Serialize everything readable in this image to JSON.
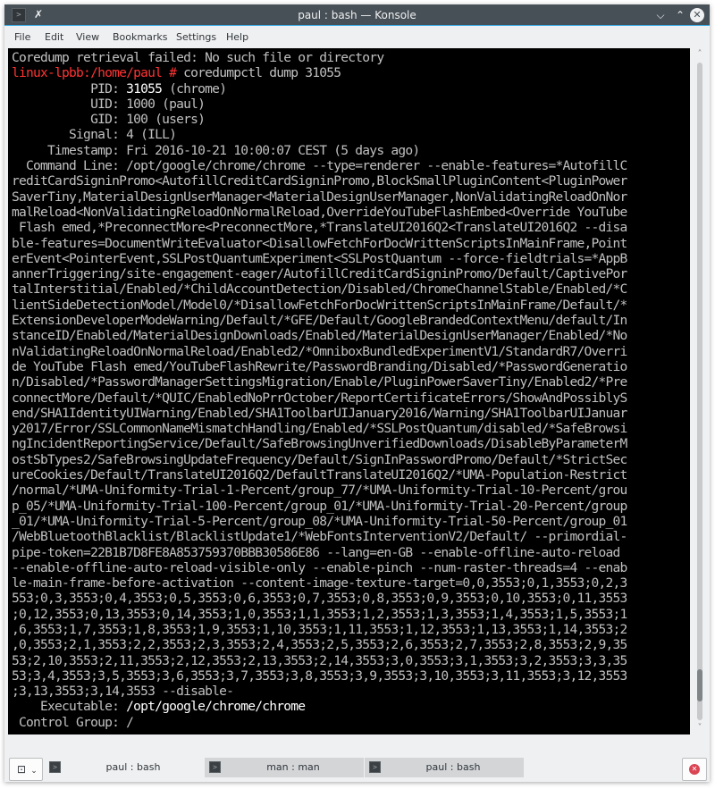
{
  "window": {
    "title": "paul : bash — Konsole",
    "icons": {
      "app": "terminal-icon",
      "pin": "pin-icon",
      "minimize": "chevron-down-icon",
      "maximize": "chevron-up-icon",
      "close": "close-icon"
    },
    "app_icon_glyph": ">",
    "pin_glyph": "✗",
    "minimize_glyph": "⌄",
    "maximize_glyph": "⌃",
    "close_glyph": "✕"
  },
  "menubar": {
    "items": [
      {
        "label": "File"
      },
      {
        "label": "Edit"
      },
      {
        "label": "View"
      },
      {
        "label": "Bookmarks"
      },
      {
        "label": "Settings"
      },
      {
        "label": "Help"
      }
    ]
  },
  "terminal": {
    "lines": [
      {
        "parts": [
          {
            "text": "Coredump retrieval failed: No such file or directory",
            "style": "normal"
          }
        ]
      },
      {
        "parts": [
          {
            "text": "linux-lpbb:/home/paul #",
            "style": "prompt"
          },
          {
            "text": " coredumpctl dump 31055",
            "style": "normal"
          }
        ]
      },
      {
        "parts": [
          {
            "text": "           PID: ",
            "style": "normal"
          },
          {
            "text": "31055",
            "style": "bright"
          },
          {
            "text": " (chrome)",
            "style": "normal"
          }
        ]
      },
      {
        "parts": [
          {
            "text": "           UID: 1000 (paul)",
            "style": "normal"
          }
        ]
      },
      {
        "parts": [
          {
            "text": "           GID: 100 (users)",
            "style": "normal"
          }
        ]
      },
      {
        "parts": [
          {
            "text": "        Signal: 4 (ILL)",
            "style": "normal"
          }
        ]
      },
      {
        "parts": [
          {
            "text": "     Timestamp: Fri 2016-10-21 10:00:07 CEST (5 days ago)",
            "style": "normal"
          }
        ]
      },
      {
        "parts": [
          {
            "text": "  Command Line: /opt/google/chrome/chrome --type=renderer --enable-features=*AutofillC",
            "style": "normal"
          }
        ]
      },
      {
        "parts": [
          {
            "text": "reditCardSigninPromo<AutofillCreditCardSigninPromo,BlockSmallPluginContent<PluginPower",
            "style": "normal"
          }
        ]
      },
      {
        "parts": [
          {
            "text": "SaverTiny,MaterialDesignUserManager<MaterialDesignUserManager,NonValidatingReloadOnNor",
            "style": "normal"
          }
        ]
      },
      {
        "parts": [
          {
            "text": "malReload<NonValidatingReloadOnNormalReload,OverrideYouTubeFlashEmbed<Override YouTube",
            "style": "normal"
          }
        ]
      },
      {
        "parts": [
          {
            "text": " Flash emed,*PreconnectMore<PreconnectMore,*TranslateUI2016Q2<TranslateUI2016Q2 --disa",
            "style": "normal"
          }
        ]
      },
      {
        "parts": [
          {
            "text": "ble-features=DocumentWriteEvaluator<DisallowFetchForDocWrittenScriptsInMainFrame,Point",
            "style": "normal"
          }
        ]
      },
      {
        "parts": [
          {
            "text": "erEvent<PointerEvent,SSLPostQuantumExperiment<SSLPostQuantum --force-fieldtrials=*AppB",
            "style": "normal"
          }
        ]
      },
      {
        "parts": [
          {
            "text": "annerTriggering/site-engagement-eager/AutofillCreditCardSigninPromo/Default/CaptivePor",
            "style": "normal"
          }
        ]
      },
      {
        "parts": [
          {
            "text": "talInterstitial/Enabled/*ChildAccountDetection/Disabled/ChromeChannelStable/Enabled/*C",
            "style": "normal"
          }
        ]
      },
      {
        "parts": [
          {
            "text": "lientSideDetectionModel/Model0/*DisallowFetchForDocWrittenScriptsInMainFrame/Default/*",
            "style": "normal"
          }
        ]
      },
      {
        "parts": [
          {
            "text": "ExtensionDeveloperModeWarning/Default/*GFE/Default/GoogleBrandedContextMenu/default/In",
            "style": "normal"
          }
        ]
      },
      {
        "parts": [
          {
            "text": "stanceID/Enabled/MaterialDesignDownloads/Enabled/MaterialDesignUserManager/Enabled/*No",
            "style": "normal"
          }
        ]
      },
      {
        "parts": [
          {
            "text": "nValidatingReloadOnNormalReload/Enabled2/*OmniboxBundledExperimentV1/StandardR7/Overri",
            "style": "normal"
          }
        ]
      },
      {
        "parts": [
          {
            "text": "de YouTube Flash emed/YouTubeFlashRewrite/PasswordBranding/Disabled/*PasswordGeneratio",
            "style": "normal"
          }
        ]
      },
      {
        "parts": [
          {
            "text": "n/Disabled/*PasswordManagerSettingsMigration/Enable/PluginPowerSaverTiny/Enabled2/*Pre",
            "style": "normal"
          }
        ]
      },
      {
        "parts": [
          {
            "text": "connectMore/Default/*QUIC/EnabledNoPrrOctober/ReportCertificateErrors/ShowAndPossiblyS",
            "style": "normal"
          }
        ]
      },
      {
        "parts": [
          {
            "text": "end/SHA1IdentityUIWarning/Enabled/SHA1ToolbarUIJanuary2016/Warning/SHA1ToolbarUIJanuar",
            "style": "normal"
          }
        ]
      },
      {
        "parts": [
          {
            "text": "y2017/Error/SSLCommonNameMismatchHandling/Enabled/*SSLPostQuantum/disabled/*SafeBrowsi",
            "style": "normal"
          }
        ]
      },
      {
        "parts": [
          {
            "text": "ngIncidentReportingService/Default/SafeBrowsingUnverifiedDownloads/DisableByParameterM",
            "style": "normal"
          }
        ]
      },
      {
        "parts": [
          {
            "text": "ostSbTypes2/SafeBrowsingUpdateFrequency/Default/SignInPasswordPromo/Default/*StrictSec",
            "style": "normal"
          }
        ]
      },
      {
        "parts": [
          {
            "text": "ureCookies/Default/TranslateUI2016Q2/DefaultTranslateUI2016Q2/*UMA-Population-Restrict",
            "style": "normal"
          }
        ]
      },
      {
        "parts": [
          {
            "text": "/normal/*UMA-Uniformity-Trial-1-Percent/group_77/*UMA-Uniformity-Trial-10-Percent/grou",
            "style": "normal"
          }
        ]
      },
      {
        "parts": [
          {
            "text": "p_05/*UMA-Uniformity-Trial-100-Percent/group_01/*UMA-Uniformity-Trial-20-Percent/group",
            "style": "normal"
          }
        ]
      },
      {
        "parts": [
          {
            "text": "_01/*UMA-Uniformity-Trial-5-Percent/group_08/*UMA-Uniformity-Trial-50-Percent/group_01",
            "style": "normal"
          }
        ]
      },
      {
        "parts": [
          {
            "text": "/WebBluetoothBlacklist/BlacklistUpdate1/*WebFontsInterventionV2/Default/ --primordial-",
            "style": "normal"
          }
        ]
      },
      {
        "parts": [
          {
            "text": "pipe-token=22B1B7D8FE8A853759370BBB30586E86 --lang=en-GB --enable-offline-auto-reload ",
            "style": "normal"
          }
        ]
      },
      {
        "parts": [
          {
            "text": "--enable-offline-auto-reload-visible-only --enable-pinch --num-raster-threads=4 --enab",
            "style": "normal"
          }
        ]
      },
      {
        "parts": [
          {
            "text": "le-main-frame-before-activation --content-image-texture-target=0,0,3553;0,1,3553;0,2,3",
            "style": "normal"
          }
        ]
      },
      {
        "parts": [
          {
            "text": "553;0,3,3553;0,4,3553;0,5,3553;0,6,3553;0,7,3553;0,8,3553;0,9,3553;0,10,3553;0,11,3553",
            "style": "normal"
          }
        ]
      },
      {
        "parts": [
          {
            "text": ";0,12,3553;0,13,3553;0,14,3553;1,0,3553;1,1,3553;1,2,3553;1,3,3553;1,4,3553;1,5,3553;1",
            "style": "normal"
          }
        ]
      },
      {
        "parts": [
          {
            "text": ",6,3553;1,7,3553;1,8,3553;1,9,3553;1,10,3553;1,11,3553;1,12,3553;1,13,3553;1,14,3553;2",
            "style": "normal"
          }
        ]
      },
      {
        "parts": [
          {
            "text": ",0,3553;2,1,3553;2,2,3553;2,3,3553;2,4,3553;2,5,3553;2,6,3553;2,7,3553;2,8,3553;2,9,35",
            "style": "normal"
          }
        ]
      },
      {
        "parts": [
          {
            "text": "53;2,10,3553;2,11,3553;2,12,3553;2,13,3553;2,14,3553;3,0,3553;3,1,3553;3,2,3553;3,3,35",
            "style": "normal"
          }
        ]
      },
      {
        "parts": [
          {
            "text": "53;3,4,3553;3,5,3553;3,6,3553;3,7,3553;3,8,3553;3,9,3553;3,10,3553;3,11,3553;3,12,3553",
            "style": "normal"
          }
        ]
      },
      {
        "parts": [
          {
            "text": ";3,13,3553;3,14,3553 --disable-",
            "style": "normal"
          }
        ]
      },
      {
        "parts": [
          {
            "text": "    Executable: ",
            "style": "normal"
          },
          {
            "text": "/opt/google/chrome/chrome",
            "style": "bright"
          }
        ]
      },
      {
        "parts": [
          {
            "text": " Control Group: /",
            "style": "normal"
          }
        ]
      }
    ]
  },
  "scrollbar": {
    "position_fraction": 0.97,
    "up_glyph": "˄",
    "down_glyph": "˅"
  },
  "tabbar": {
    "new_tab_glyph": "⧉",
    "new_tab_chevron": "⌄",
    "tabs": [
      {
        "label": "paul : bash",
        "active": true,
        "icon_glyph": ">"
      },
      {
        "label": "man : man",
        "active": false,
        "icon_glyph": ">"
      },
      {
        "label": "paul : bash",
        "active": false,
        "icon_glyph": ">"
      }
    ],
    "close_glyph": "✕"
  },
  "colors": {
    "titlebar": "#475057",
    "accent": "#3daee9",
    "terminal_bg": "#000000",
    "terminal_fg": "#c0c0c0",
    "prompt": "#ff3333",
    "close_tab": "#da4453"
  }
}
